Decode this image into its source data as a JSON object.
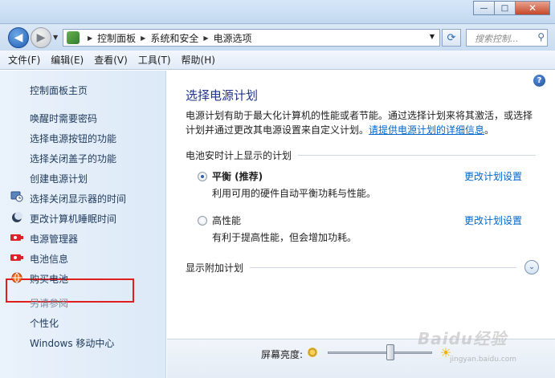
{
  "window": {
    "minimize": "—",
    "maximize": "□",
    "close": "✕"
  },
  "nav": {
    "back": "◀",
    "forward": "▶",
    "breadcrumbs": [
      "控制面板",
      "系统和安全",
      "电源选项"
    ],
    "search_placeholder": "搜索控制...",
    "search_icon": "magnifier-icon",
    "refresh_icon": "refresh-icon"
  },
  "menu": [
    "文件(F)",
    "编辑(E)",
    "查看(V)",
    "工具(T)",
    "帮助(H)"
  ],
  "sidebar": {
    "home": "控制面板主页",
    "links": [
      "唤醒时需要密码",
      "选择电源按钮的功能",
      "选择关闭盖子的功能",
      "创建电源计划",
      "选择关闭显示器的时间",
      "更改计算机睡眠时间",
      "电源管理器",
      "电池信息",
      "购买电池"
    ],
    "see_also_heading": "另请参阅",
    "see_also": [
      "个性化",
      "Windows 移动中心"
    ]
  },
  "main": {
    "help": "?",
    "title": "选择电源计划",
    "desc_line1": "电源计划有助于最大化计算机的性能或者节能。通过选择计划来将其激活，或选择",
    "desc_line2": "计划并通过更改其电源设置来自定义计划。",
    "desc_link": "请提供电源计划的详细信息",
    "desc_end": "。",
    "section_battery": "电池安时计上显示的计划",
    "plans": [
      {
        "name": "平衡 (推荐)",
        "desc": "利用可用的硬件自动平衡功耗与性能。",
        "link": "更改计划设置",
        "selected": true
      },
      {
        "name": "高性能",
        "desc": "有利于提高性能，但会增加功耗。",
        "link": "更改计划设置",
        "selected": false
      }
    ],
    "section_extra": "显示附加计划",
    "expand": "⌄"
  },
  "brightness": {
    "label": "屏幕亮度:",
    "level": 0.6
  },
  "watermark": {
    "text": "Baidu经验",
    "sub": "jingyan.baidu.com"
  }
}
